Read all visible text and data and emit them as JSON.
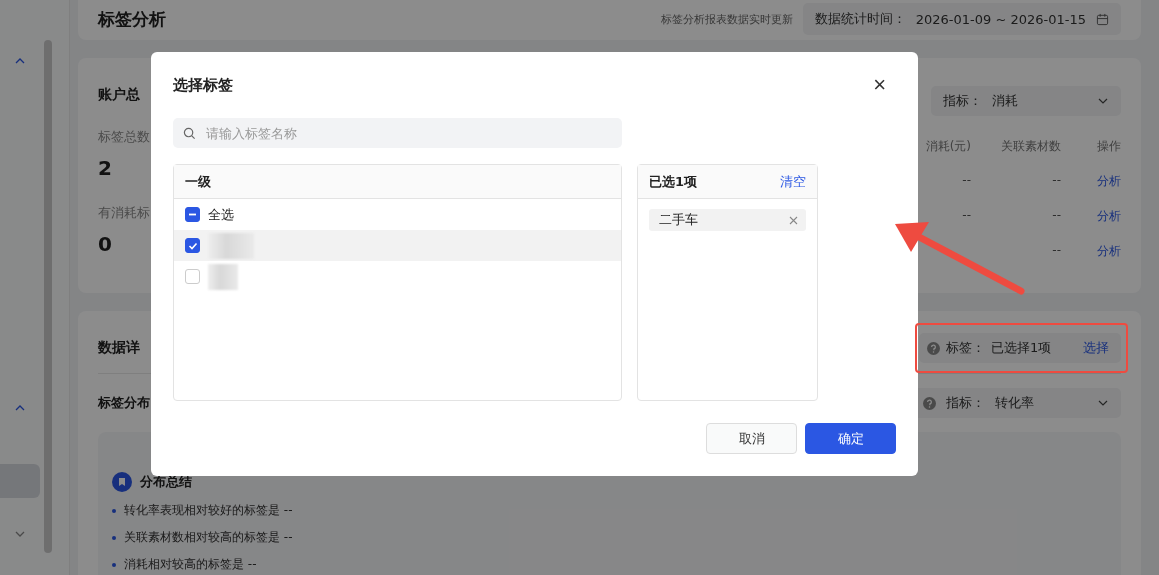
{
  "sidebar": {
    "items": [
      {
        "kind": "up"
      },
      {
        "kind": "up"
      },
      {
        "kind": "block"
      },
      {
        "kind": "down"
      }
    ]
  },
  "header": {
    "title": "标签分析",
    "note": "标签分析报表数据实时更新",
    "date_label": "数据统计时间：",
    "date_range": "2026-01-09 ~ 2026-01-15"
  },
  "overview": {
    "title": "账户总",
    "stats": [
      {
        "label": "标签总数",
        "value": "2"
      },
      {
        "label": "有消耗标",
        "value": "0"
      }
    ],
    "metric": {
      "label": "指标：",
      "value": "消耗"
    },
    "table": {
      "columns": [
        "消耗(元)",
        "关联素材数",
        "操作"
      ],
      "rows": [
        {
          "cost": "--",
          "materials": "--",
          "action": "分析"
        },
        {
          "cost": "--",
          "materials": "--",
          "action": "分析"
        },
        {
          "materials": "--",
          "action": "分析"
        }
      ]
    }
  },
  "details": {
    "title": "数据详",
    "tag_filter": {
      "label": "标签：",
      "value": "已选择1项",
      "action": "选择"
    },
    "distribution": {
      "title": "标签分布",
      "metric": {
        "label": "指标：",
        "value": "转化率"
      },
      "summary": {
        "title": "分布总结",
        "bullets": [
          "转化率表现相对较好的标签是 --",
          "关联素材数相对较高的标签是 --",
          "消耗相对较高的标签是 --"
        ]
      }
    }
  },
  "modal": {
    "title": "选择标签",
    "close": "×",
    "search": {
      "placeholder": "请输入标签名称"
    },
    "left": {
      "header": "一级",
      "select_all": {
        "label": "全选",
        "indeterminate": true
      },
      "items": [
        {
          "checked": true,
          "selected": true
        },
        {
          "checked": false,
          "selected": false
        }
      ]
    },
    "right": {
      "header": "已选1项",
      "clear": "清空",
      "chips": [
        {
          "label": "二手车"
        }
      ]
    },
    "buttons": [
      {
        "label": "取消",
        "kind": "secondary"
      },
      {
        "label": "确定",
        "kind": "primary"
      }
    ]
  },
  "annotation": {
    "arrow": true,
    "highlight_box": true
  }
}
